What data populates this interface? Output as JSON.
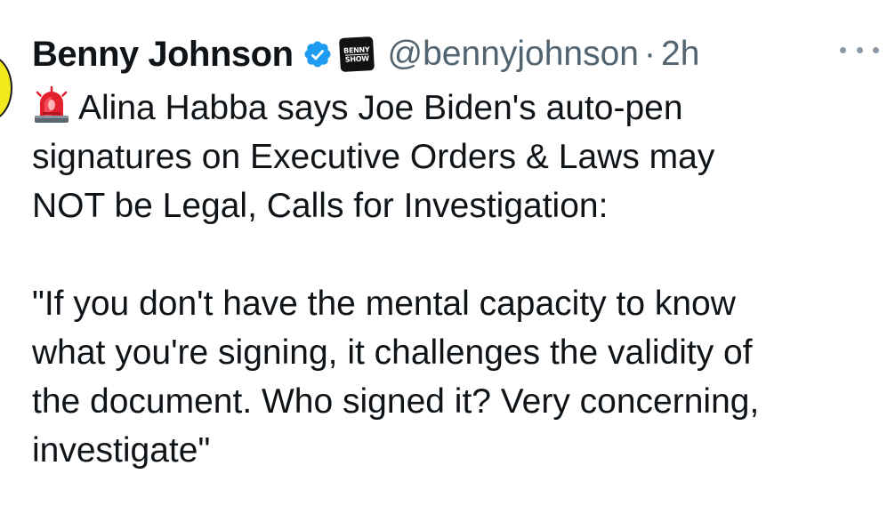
{
  "tweet": {
    "display_name": "Benny Johnson",
    "badge_line1": "BENNY",
    "badge_line2": "SHOW",
    "handle": "@bennyjohnson",
    "separator": "·",
    "time": "2h",
    "lines": [
      "Alina Habba says Joe Biden's auto-pen",
      "signatures on Executive Orders & Laws may",
      "NOT be Legal, Calls for Investigation:",
      "",
      "\"If you don't have the mental capacity to know",
      "what you're signing, it challenges the validity of",
      "the document. Who signed it? Very concerning,",
      "investigate\""
    ]
  },
  "icons": {
    "verified": "verified-check-icon",
    "siren": "police-siren-emoji",
    "more": "more-dots-icon"
  },
  "colors": {
    "text": "#0f1419",
    "secondary": "#536471",
    "verified_blue": "#1d9bf0",
    "avatar_yellow": "#f2ea1d"
  }
}
